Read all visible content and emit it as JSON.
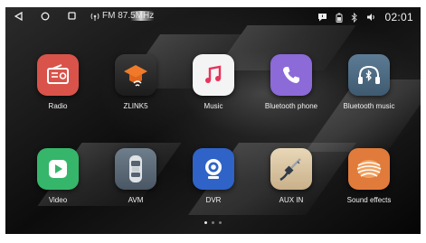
{
  "statusbar": {
    "radio_text": "FM 87.5MHz",
    "time": "02:01",
    "left_icons": [
      "back-icon",
      "home-icon",
      "recents-icon"
    ],
    "right_icons": [
      "message-icon",
      "battery-icon",
      "bluetooth-icon",
      "volume-icon"
    ]
  },
  "apps": [
    {
      "label": "Radio",
      "icon": "radio-icon",
      "color": "#d9534a"
    },
    {
      "label": "ZLINK5",
      "icon": "zlink-icon",
      "color": "#2a2a2a"
    },
    {
      "label": "Music",
      "icon": "music-note-icon",
      "color": "#f4f4f4"
    },
    {
      "label": "Bluetooth phone",
      "icon": "phone-icon",
      "color": "#8c6ad8"
    },
    {
      "label": "Bluetooth music",
      "icon": "bluetooth-headphones-icon",
      "color": "#4d6a82"
    },
    {
      "label": "Video",
      "icon": "play-icon",
      "color": "#36b66a"
    },
    {
      "label": "AVM",
      "icon": "car-icon",
      "color": "#5d6b78"
    },
    {
      "label": "DVR",
      "icon": "camera-icon",
      "color": "#2f63c7"
    },
    {
      "label": "AUX IN",
      "icon": "aux-cable-icon",
      "color": "#d8c3a0"
    },
    {
      "label": "Sound effects",
      "icon": "sound-wave-icon",
      "color": "#e07b3b"
    }
  ],
  "pager": {
    "pages": 3,
    "current": 1
  }
}
